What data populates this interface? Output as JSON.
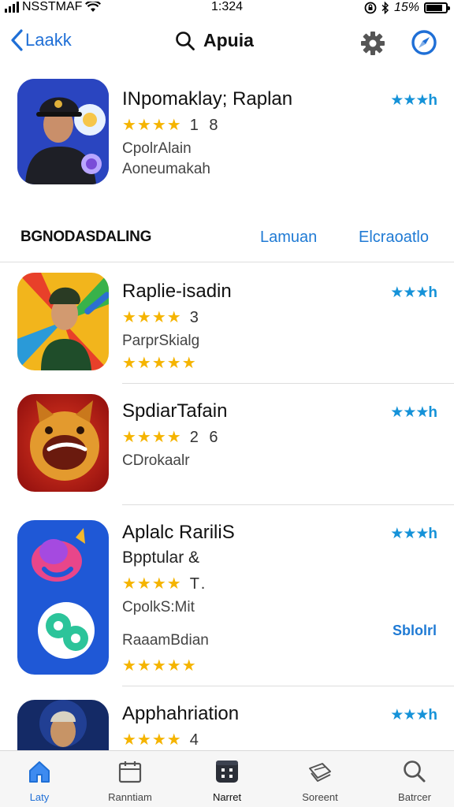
{
  "status": {
    "carrier": "NSSTMAF",
    "time": "1:324",
    "battery": "15%"
  },
  "nav": {
    "back_label": "Laakk",
    "title": "Apuia"
  },
  "featured": {
    "name": "INpomaklay; Raplan",
    "rating_count": "1 8",
    "line1": "CpolrAlain",
    "line2": "Aoneumakah",
    "mini_rating": "★★★h"
  },
  "section": {
    "title": "BGNODASDALING",
    "link1": "Lamuan",
    "link2": "Elcraoatlo"
  },
  "apps": [
    {
      "name": "Raplie-isadin",
      "rating_count": "3",
      "line1": "ParprSkialg",
      "mini_rating": "★★★h"
    },
    {
      "name": "SpdiarTafain",
      "rating_count": "2 6",
      "line1": "CDrokaalr",
      "mini_rating": "★★★h"
    },
    {
      "name": "Aplalc RariliS",
      "line0": "Bpptular &",
      "rating_count": "T.",
      "line1": "CpolkS:Mit",
      "line2": "RaaamBdian",
      "mini_rating": "★★★h",
      "mini_text": "Sblolrl"
    },
    {
      "name": "Apphahriation",
      "rating_count": "4",
      "mini_rating": "★★★h"
    }
  ],
  "tabs": [
    {
      "label": "Laty"
    },
    {
      "label": "Ranntiam"
    },
    {
      "label": "Narret"
    },
    {
      "label": "Soreent"
    },
    {
      "label": "Batrcer"
    }
  ],
  "colors": {
    "accent": "#1f6fd6",
    "star": "#f5b400",
    "mini_star": "#1592d8"
  }
}
